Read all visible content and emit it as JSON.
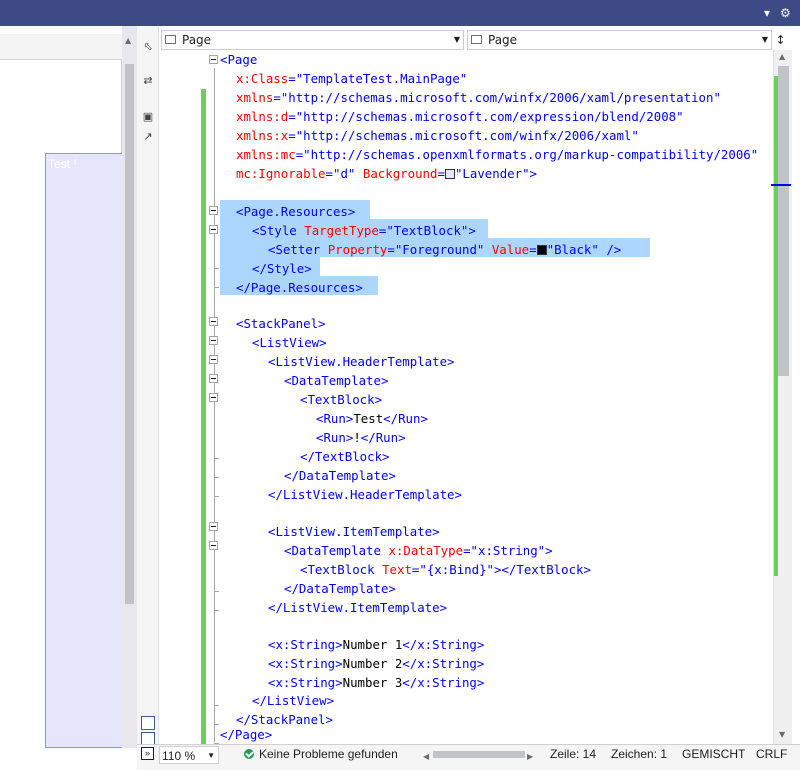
{
  "colors": {
    "titlebar": "#3e4a86",
    "selection": "#add6ff",
    "change_bar": "#6bd05b",
    "designer_background": "#e6e6fa",
    "swatch_background": "#e6e6fa",
    "swatch_foreground": "#000000"
  },
  "icons": {
    "titlebar": [
      "chevron-down-icon",
      "gear-icon"
    ],
    "sidebar": [
      "pointer-icon",
      "swap-icon",
      "xaml-icon",
      "open-window-icon",
      "split-horizontal-icon",
      "split-vertical-icon",
      "expand-icon"
    ],
    "status": "check-circle-icon"
  },
  "designer": {
    "preview_text": "Test !"
  },
  "nav": {
    "left_dropdown": "Page",
    "right_dropdown": "Page"
  },
  "code": {
    "l0": "<Page",
    "l1_attr": "x:Class",
    "l1_val": "\"TemplateTest.MainPage\"",
    "l2_attr": "xmlns",
    "l2_val": "\"http://schemas.microsoft.com/winfx/2006/xaml/presentation\"",
    "l3_attr": "xmlns:d",
    "l3_val": "\"http://schemas.microsoft.com/expression/blend/2008\"",
    "l4_attr": "xmlns:x",
    "l4_val": "\"http://schemas.microsoft.com/winfx/2006/xaml\"",
    "l5_attr": "xmlns:mc",
    "l5_val": "\"http://schemas.openxmlformats.org/markup-compatibility/2006\"",
    "l6_attr1": "mc:Ignorable",
    "l6_val1": "\"d\"",
    "l6_attr2": "Background",
    "l6_val2": "\"Lavender\"",
    "l6_end": ">",
    "l8": "<Page.Resources>",
    "l9_tag": "<Style",
    "l9_attr": "TargetType",
    "l9_val": "\"TextBlock\"",
    "l9_end": ">",
    "l10_tag": "<Setter",
    "l10_attr1": "Property",
    "l10_val1": "\"Foreground\"",
    "l10_attr2": "Value",
    "l10_val2": "\"Black\"",
    "l10_end": "/>",
    "l11": "</Style>",
    "l12": "</Page.Resources>",
    "l14": "<StackPanel>",
    "l15": "<ListView>",
    "l16": "<ListView.HeaderTemplate>",
    "l17": "<DataTemplate>",
    "l18": "<TextBlock>",
    "l19_open": "<Run>",
    "l19_text": "Test",
    "l19_close": "</Run>",
    "l20_open": "<Run>",
    "l20_text": "!",
    "l20_close": "</Run>",
    "l21": "</TextBlock>",
    "l22": "</DataTemplate>",
    "l23": "</ListView.HeaderTemplate>",
    "l25": "<ListView.ItemTemplate>",
    "l26_tag": "<DataTemplate",
    "l26_attr": "x:DataType",
    "l26_val": "\"x:String\"",
    "l26_end": ">",
    "l27_tag": "<TextBlock",
    "l27_attr": "Text",
    "l27_val": "\"{x:Bind}\"",
    "l27_end": "></TextBlock>",
    "l28": "</DataTemplate>",
    "l29": "</ListView.ItemTemplate>",
    "l31_open": "<x:String>",
    "l31_text": "Number 1",
    "l31_close": "</x:String>",
    "l32_open": "<x:String>",
    "l32_text": "Number 2",
    "l32_close": "</x:String>",
    "l33_open": "<x:String>",
    "l33_text": "Number 3",
    "l33_close": "</x:String>",
    "l34": "</ListView>",
    "l35": "</StackPanel>",
    "l36": "</Page>"
  },
  "status": {
    "zoom": "110 %",
    "message": "Keine Probleme gefunden",
    "line": "Zeile: 14",
    "char": "Zeichen: 1",
    "mode": "GEMISCHT",
    "eol": "CRLF"
  }
}
